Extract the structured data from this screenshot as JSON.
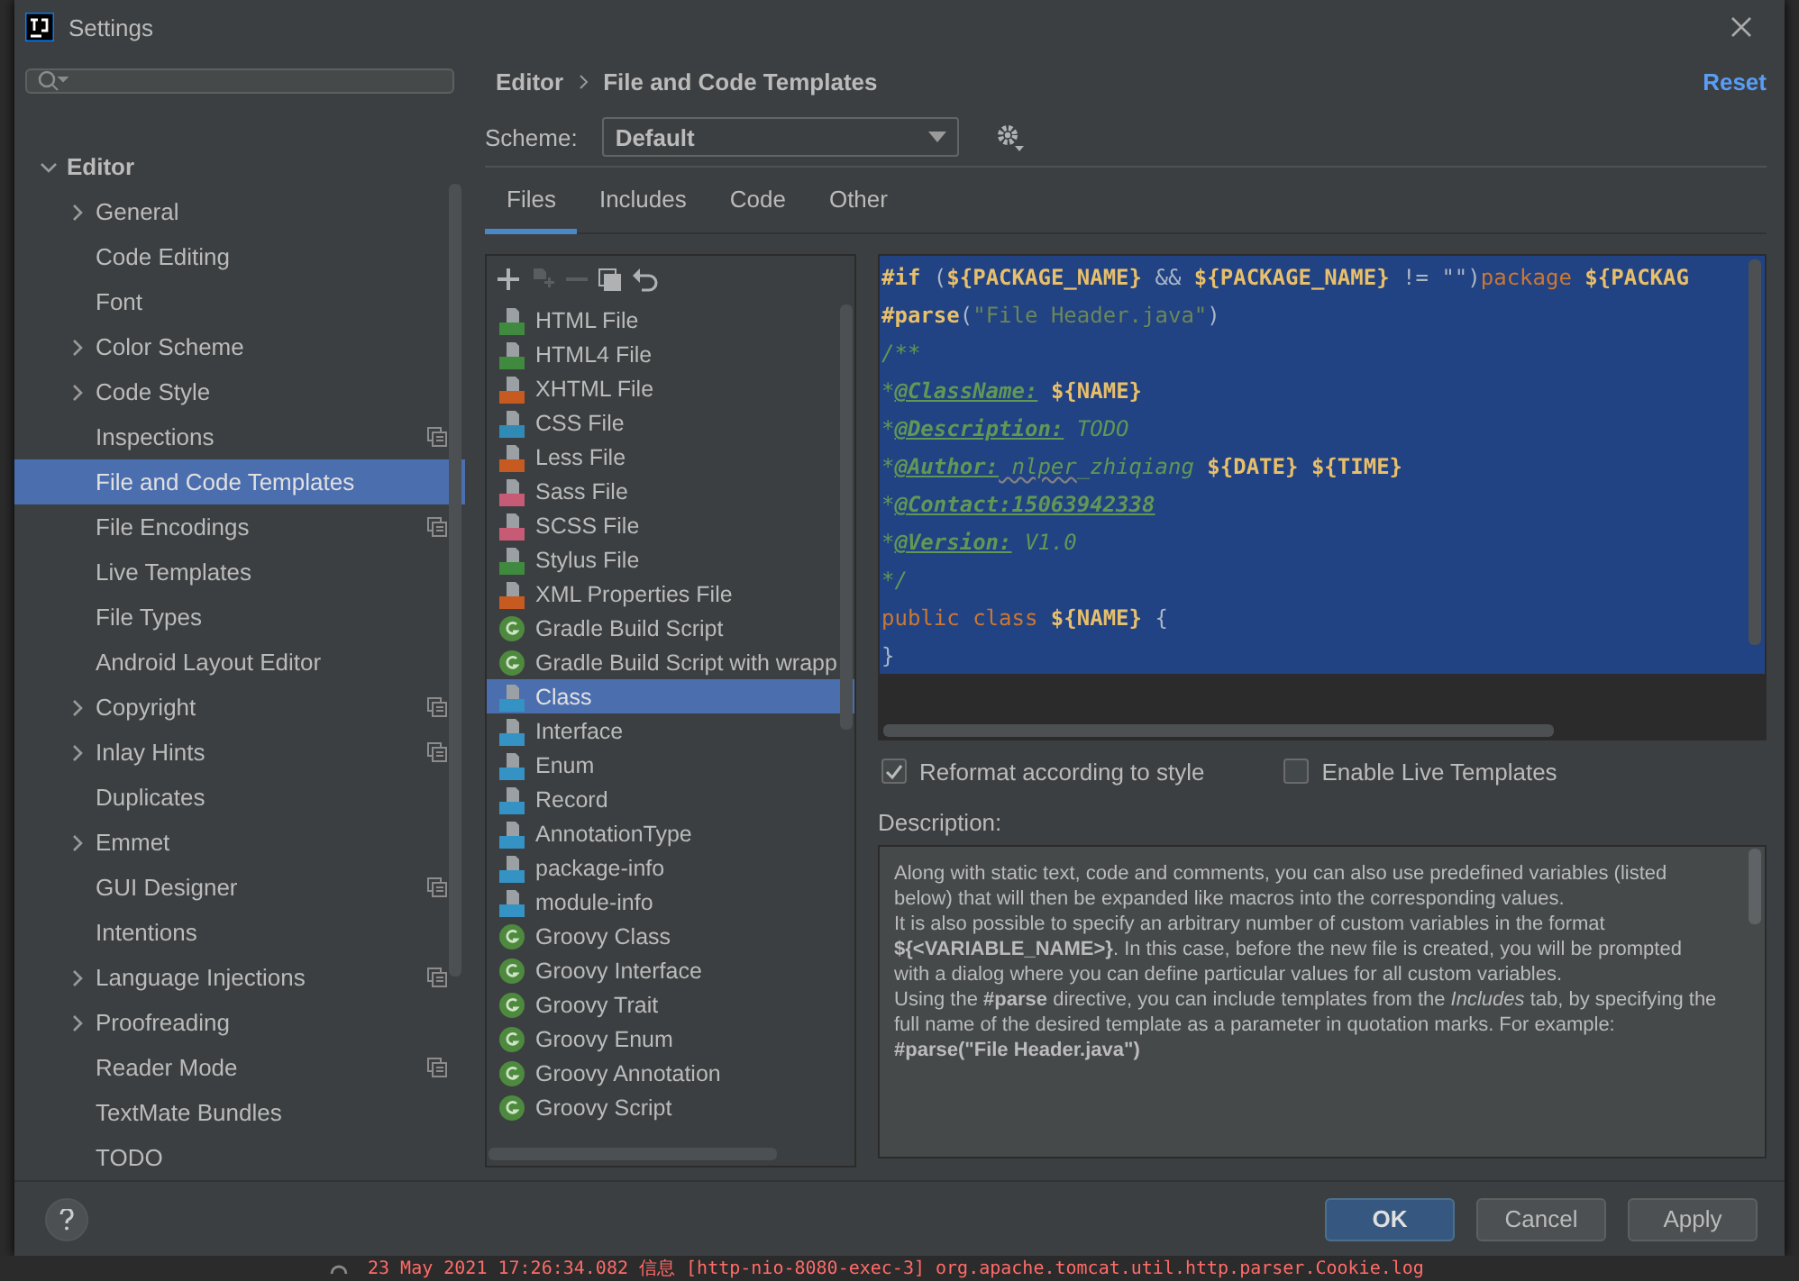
{
  "window": {
    "title": "Settings"
  },
  "sidebar": {
    "items": [
      {
        "label": "Editor",
        "kind": "group",
        "expanded": true,
        "selected": false,
        "scoped": false,
        "children": [
          {
            "label": "General",
            "kind": "group",
            "expanded": false,
            "selected": false,
            "scoped": false
          },
          {
            "label": "Code Editing",
            "kind": "page",
            "selected": false,
            "scoped": false
          },
          {
            "label": "Font",
            "kind": "page",
            "selected": false,
            "scoped": false
          },
          {
            "label": "Color Scheme",
            "kind": "group",
            "expanded": false,
            "selected": false,
            "scoped": false
          },
          {
            "label": "Code Style",
            "kind": "group",
            "expanded": false,
            "selected": false,
            "scoped": false
          },
          {
            "label": "Inspections",
            "kind": "page",
            "selected": false,
            "scoped": true
          },
          {
            "label": "File and Code Templates",
            "kind": "page",
            "selected": true,
            "scoped": false
          },
          {
            "label": "File Encodings",
            "kind": "page",
            "selected": false,
            "scoped": true
          },
          {
            "label": "Live Templates",
            "kind": "page",
            "selected": false,
            "scoped": false
          },
          {
            "label": "File Types",
            "kind": "page",
            "selected": false,
            "scoped": false
          },
          {
            "label": "Android Layout Editor",
            "kind": "page",
            "selected": false,
            "scoped": false
          },
          {
            "label": "Copyright",
            "kind": "group",
            "expanded": false,
            "selected": false,
            "scoped": true
          },
          {
            "label": "Inlay Hints",
            "kind": "group",
            "expanded": false,
            "selected": false,
            "scoped": true
          },
          {
            "label": "Duplicates",
            "kind": "page",
            "selected": false,
            "scoped": false
          },
          {
            "label": "Emmet",
            "kind": "group",
            "expanded": false,
            "selected": false,
            "scoped": false
          },
          {
            "label": "GUI Designer",
            "kind": "page",
            "selected": false,
            "scoped": true
          },
          {
            "label": "Intentions",
            "kind": "page",
            "selected": false,
            "scoped": false
          },
          {
            "label": "Language Injections",
            "kind": "group",
            "expanded": false,
            "selected": false,
            "scoped": true
          },
          {
            "label": "Proofreading",
            "kind": "group",
            "expanded": false,
            "selected": false,
            "scoped": false
          },
          {
            "label": "Reader Mode",
            "kind": "page",
            "selected": false,
            "scoped": true
          },
          {
            "label": "TextMate Bundles",
            "kind": "page",
            "selected": false,
            "scoped": false
          },
          {
            "label": "TODO",
            "kind": "page",
            "selected": false,
            "scoped": false
          }
        ]
      }
    ]
  },
  "breadcrumb": [
    "Editor",
    "File and Code Templates"
  ],
  "reset": "Reset",
  "scheme": {
    "label": "Scheme:",
    "value": "Default"
  },
  "tabs": [
    {
      "label": "Files",
      "selected": true
    },
    {
      "label": "Includes",
      "selected": false
    },
    {
      "label": "Code",
      "selected": false
    },
    {
      "label": "Other",
      "selected": false
    }
  ],
  "templates": [
    {
      "label": "HTML File",
      "kind": "file",
      "color": "#3f8a3f",
      "selected": false
    },
    {
      "label": "HTML4 File",
      "kind": "file",
      "color": "#3f8a3f",
      "selected": false
    },
    {
      "label": "XHTML File",
      "kind": "file",
      "color": "#c75a21",
      "selected": false
    },
    {
      "label": "CSS File",
      "kind": "file",
      "color": "#2f8bb5",
      "selected": false
    },
    {
      "label": "Less File",
      "kind": "file",
      "color": "#c75a21",
      "selected": false
    },
    {
      "label": "Sass File",
      "kind": "file",
      "color": "#c75b76",
      "selected": false
    },
    {
      "label": "SCSS File",
      "kind": "file",
      "color": "#c75b76",
      "selected": false
    },
    {
      "label": "Stylus File",
      "kind": "file",
      "color": "#3f8a3f",
      "selected": false
    },
    {
      "label": "XML Properties File",
      "kind": "file",
      "color": "#c75a21",
      "selected": false
    },
    {
      "label": "Gradle Build Script",
      "kind": "groovy",
      "selected": false
    },
    {
      "label": "Gradle Build Script with wrapp",
      "kind": "groovy",
      "selected": false
    },
    {
      "label": "Class",
      "kind": "file",
      "color": "#3592c4",
      "selected": true
    },
    {
      "label": "Interface",
      "kind": "file",
      "color": "#3592c4",
      "selected": false
    },
    {
      "label": "Enum",
      "kind": "file",
      "color": "#3592c4",
      "selected": false
    },
    {
      "label": "Record",
      "kind": "file",
      "color": "#3592c4",
      "selected": false
    },
    {
      "label": "AnnotationType",
      "kind": "file",
      "color": "#3592c4",
      "selected": false
    },
    {
      "label": "package-info",
      "kind": "file",
      "color": "#3592c4",
      "selected": false
    },
    {
      "label": "module-info",
      "kind": "file",
      "color": "#3592c4",
      "selected": false
    },
    {
      "label": "Groovy Class",
      "kind": "groovy",
      "selected": false
    },
    {
      "label": "Groovy Interface",
      "kind": "groovy",
      "selected": false
    },
    {
      "label": "Groovy Trait",
      "kind": "groovy",
      "selected": false
    },
    {
      "label": "Groovy Enum",
      "kind": "groovy",
      "selected": false
    },
    {
      "label": "Groovy Annotation",
      "kind": "groovy",
      "selected": false
    },
    {
      "label": "Groovy Script",
      "kind": "groovy",
      "selected": false
    }
  ],
  "editor": {
    "lines": [
      [
        {
          "kind": "directive",
          "text": "#if"
        },
        {
          "kind": "plain",
          "text": " ("
        },
        {
          "kind": "var",
          "text": "${PACKAGE_NAME}"
        },
        {
          "kind": "plain",
          "text": " && "
        },
        {
          "kind": "var",
          "text": "${PACKAGE_NAME}"
        },
        {
          "kind": "plain",
          "text": " != \"\")"
        },
        {
          "kind": "keyword",
          "text": "package "
        },
        {
          "kind": "var",
          "text": "${PACKAG"
        }
      ],
      [
        {
          "kind": "directive",
          "text": "#parse"
        },
        {
          "kind": "plain",
          "text": "("
        },
        {
          "kind": "string",
          "text": "\"File Header.java\""
        },
        {
          "kind": "plain",
          "text": ")"
        }
      ],
      [
        {
          "kind": "comment",
          "text": "/**"
        }
      ],
      [
        {
          "kind": "comment",
          "text": "*"
        },
        {
          "kind": "doctag",
          "text": "@ClassName:"
        },
        {
          "kind": "var",
          "text": " ${NAME}"
        }
      ],
      [
        {
          "kind": "comment",
          "text": "*"
        },
        {
          "kind": "doctag",
          "text": "@Description:"
        },
        {
          "kind": "docval",
          "text": " TODO"
        }
      ],
      [
        {
          "kind": "comment",
          "text": "*"
        },
        {
          "kind": "doctag",
          "text": "@Author:"
        },
        {
          "kind": "typo",
          "text": " nlper"
        },
        {
          "kind": "docval",
          "text": "_zhiqiang"
        },
        {
          "kind": "var",
          "text": " ${DATE}"
        },
        {
          "kind": "var",
          "text": " ${TIME}"
        }
      ],
      [
        {
          "kind": "comment",
          "text": "*"
        },
        {
          "kind": "doctag",
          "text": "@Contact:15063942338"
        }
      ],
      [
        {
          "kind": "comment",
          "text": "*"
        },
        {
          "kind": "doctag",
          "text": "@Version:"
        },
        {
          "kind": "docval",
          "text": " V1.0"
        }
      ],
      [
        {
          "kind": "comment",
          "text": "*/"
        }
      ],
      [
        {
          "kind": "keyword",
          "text": "public class "
        },
        {
          "kind": "var",
          "text": "${NAME}"
        },
        {
          "kind": "plain",
          "text": " {"
        }
      ],
      [
        {
          "kind": "plain",
          "text": "}"
        }
      ]
    ]
  },
  "options": [
    {
      "label": "Reformat according to style",
      "checked": true
    },
    {
      "label": "Enable Live Templates",
      "checked": false
    }
  ],
  "description": {
    "label": "Description:",
    "paragraphs": [
      {
        "kind": "text",
        "text": "Along with static text, code and comments, you can also use predefined variables (listed below) that will then be expanded like macros into the corresponding values."
      },
      {
        "kind": "text",
        "text": "It is also possible to specify an arbitrary number of custom variables in the format **${<VARIABLE_NAME>}**. In this case, before the new file is created, you will be prompted with a dialog where you can define particular values for all custom variables."
      },
      {
        "kind": "text",
        "text": "Using the **#parse** directive, you can include templates from the *Includes* tab, by specifying the full name of the desired template as a parameter in quotation marks. For example:"
      },
      {
        "kind": "code",
        "text": "#parse(\"File Header.java\")"
      }
    ]
  },
  "buttons": [
    {
      "label": "OK",
      "kind": "primary"
    },
    {
      "label": "Cancel",
      "kind": "normal"
    },
    {
      "label": "Apply",
      "kind": "normal"
    }
  ],
  "log": {
    "text": "23 May 2021 17:26:34.082 信息 [http-nio-8080-exec-3] org.apache.tomcat.util.http.parser.Cookie.log"
  }
}
